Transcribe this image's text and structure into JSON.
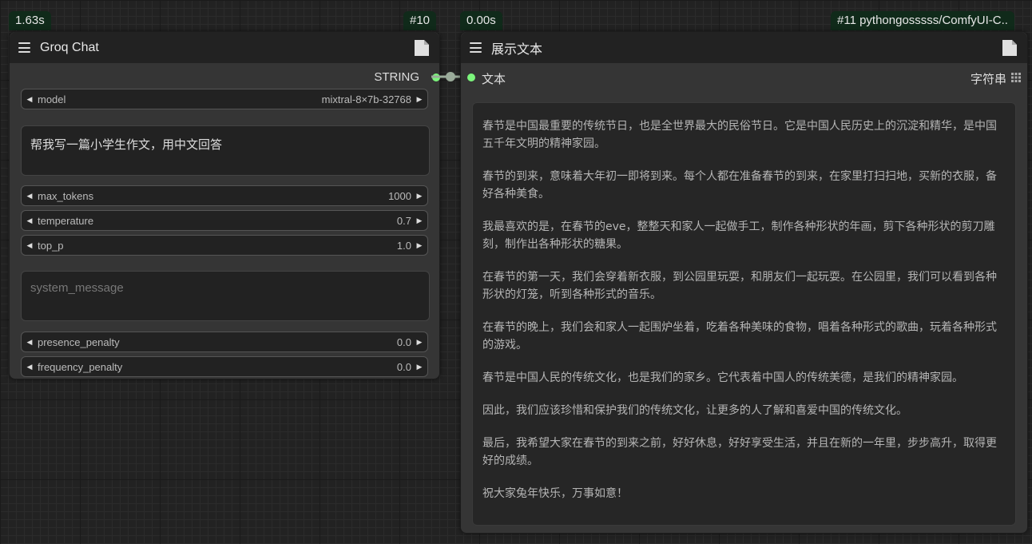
{
  "node1": {
    "timing": "1.63s",
    "id": "#10",
    "title": "Groq Chat",
    "output_label": "STRING",
    "model": {
      "name": "model",
      "value": "mixtral-8×7b-32768"
    },
    "prompt": "帮我写一篇小学生作文，用中文回答",
    "max_tokens": {
      "name": "max_tokens",
      "value": "1000"
    },
    "temperature": {
      "name": "temperature",
      "value": "0.7"
    },
    "top_p": {
      "name": "top_p",
      "value": "1.0"
    },
    "system_message_placeholder": "system_message",
    "presence_penalty": {
      "name": "presence_penalty",
      "value": "0.0"
    },
    "frequency_penalty": {
      "name": "frequency_penalty",
      "value": "0.0"
    }
  },
  "node2": {
    "timing": "0.00s",
    "id": "#11 pythongosssss/ComfyUI-C..",
    "title": "展示文本",
    "input_label": "文本",
    "output_label": "字符串",
    "paragraphs": [
      "春节是中国最重要的传统节日，也是全世界最大的民俗节日。它是中国人民历史上的沉淀和精华，是中国五千年文明的精神家园。",
      "春节的到来，意味着大年初一即将到来。每个人都在准备春节的到来，在家里打扫扫地，买新的衣服，备好各种美食。",
      "我最喜欢的是，在春节的eve，整整天和家人一起做手工，制作各种形状的年画，剪下各种形状的剪刀雕刻，制作出各种形状的糖果。",
      "在春节的第一天，我们会穿着新衣服，到公园里玩耍，和朋友们一起玩耍。在公园里，我们可以看到各种形状的灯笼，听到各种形式的音乐。",
      "在春节的晚上，我们会和家人一起围炉坐着，吃着各种美味的食物，唱着各种形式的歌曲，玩着各种形式的游戏。",
      "春节是中国人民的传统文化，也是我们的家乡。它代表着中国人的传统美德，是我们的精神家园。",
      "因此，我们应该珍惜和保护我们的传统文化，让更多的人了解和喜爱中国的传统文化。",
      "最后，我希望大家在春节的到来之前，好好休息，好好享受生活，并且在新的一年里，步步高升，取得更好的成绩。",
      "祝大家兔年快乐，万事如意！"
    ]
  },
  "colors": {
    "connection_dot": "#7CF57C",
    "badge_bg": "#102a1a"
  }
}
